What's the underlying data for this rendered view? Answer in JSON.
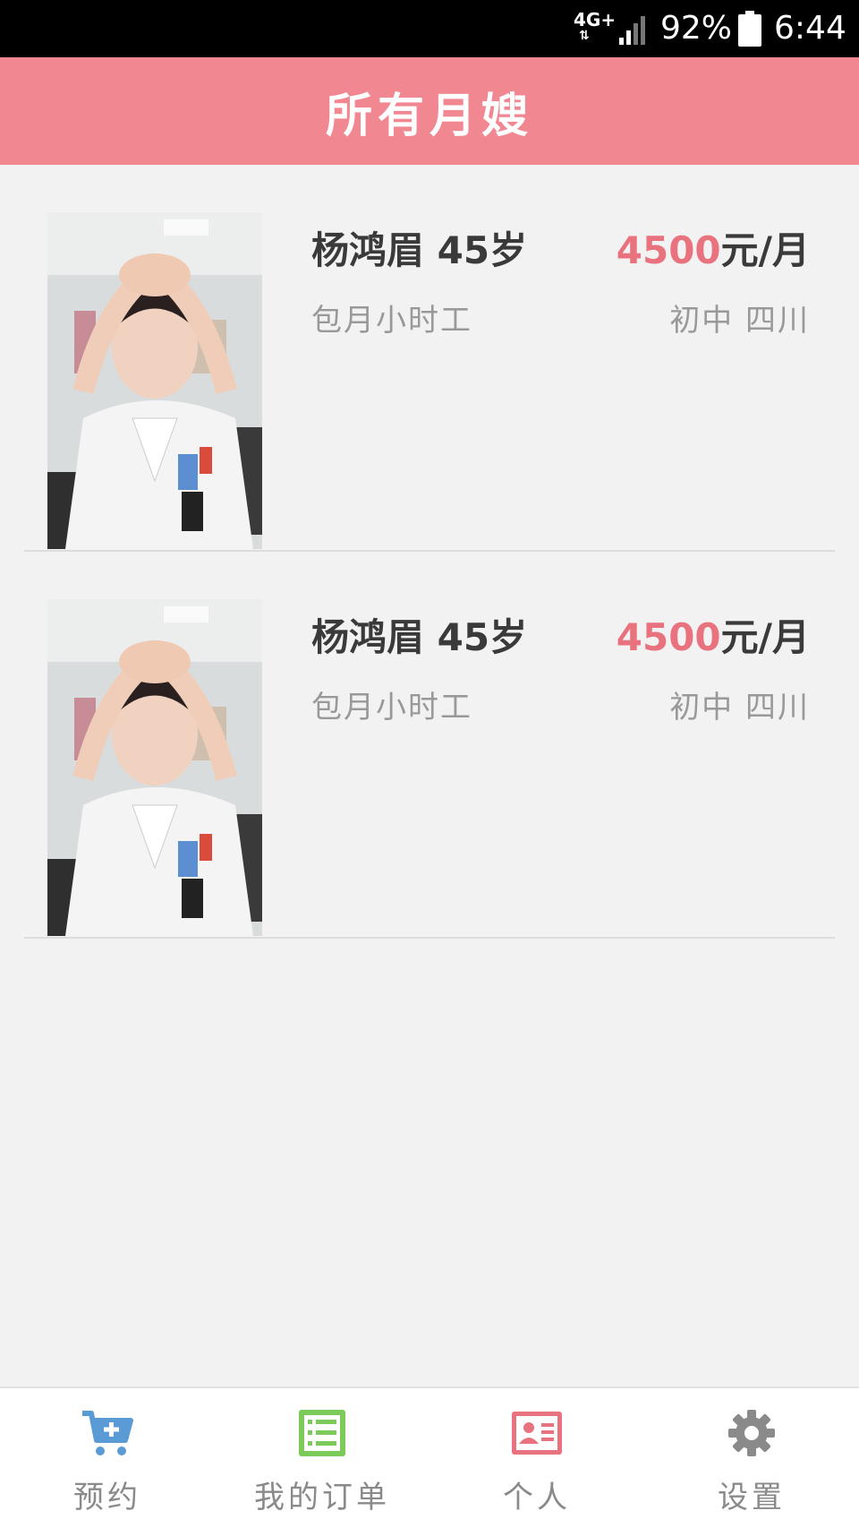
{
  "status_bar": {
    "network": "4G+",
    "battery_percent": "92%",
    "time": "6:44"
  },
  "header": {
    "title": "所有月嫂"
  },
  "listings": [
    {
      "name_age": "杨鸿眉 45岁",
      "price_amount": "4500",
      "price_unit": "元/月",
      "job_type": "包月小时工",
      "education_region": "初中 四川"
    },
    {
      "name_age": "杨鸿眉 45岁",
      "price_amount": "4500",
      "price_unit": "元/月",
      "job_type": "包月小时工",
      "education_region": "初中 四川"
    }
  ],
  "bottom_nav": {
    "items": [
      {
        "label": "预约",
        "icon": "cart-add-icon",
        "color": "#5b9bd5"
      },
      {
        "label": "我的订单",
        "icon": "list-icon",
        "color": "#7ccb5a"
      },
      {
        "label": "个人",
        "icon": "id-card-icon",
        "color": "#e9727f"
      },
      {
        "label": "设置",
        "icon": "gear-icon",
        "color": "#8a8a8a"
      }
    ]
  },
  "colors": {
    "accent": "#f18791",
    "price": "#e9727f"
  }
}
